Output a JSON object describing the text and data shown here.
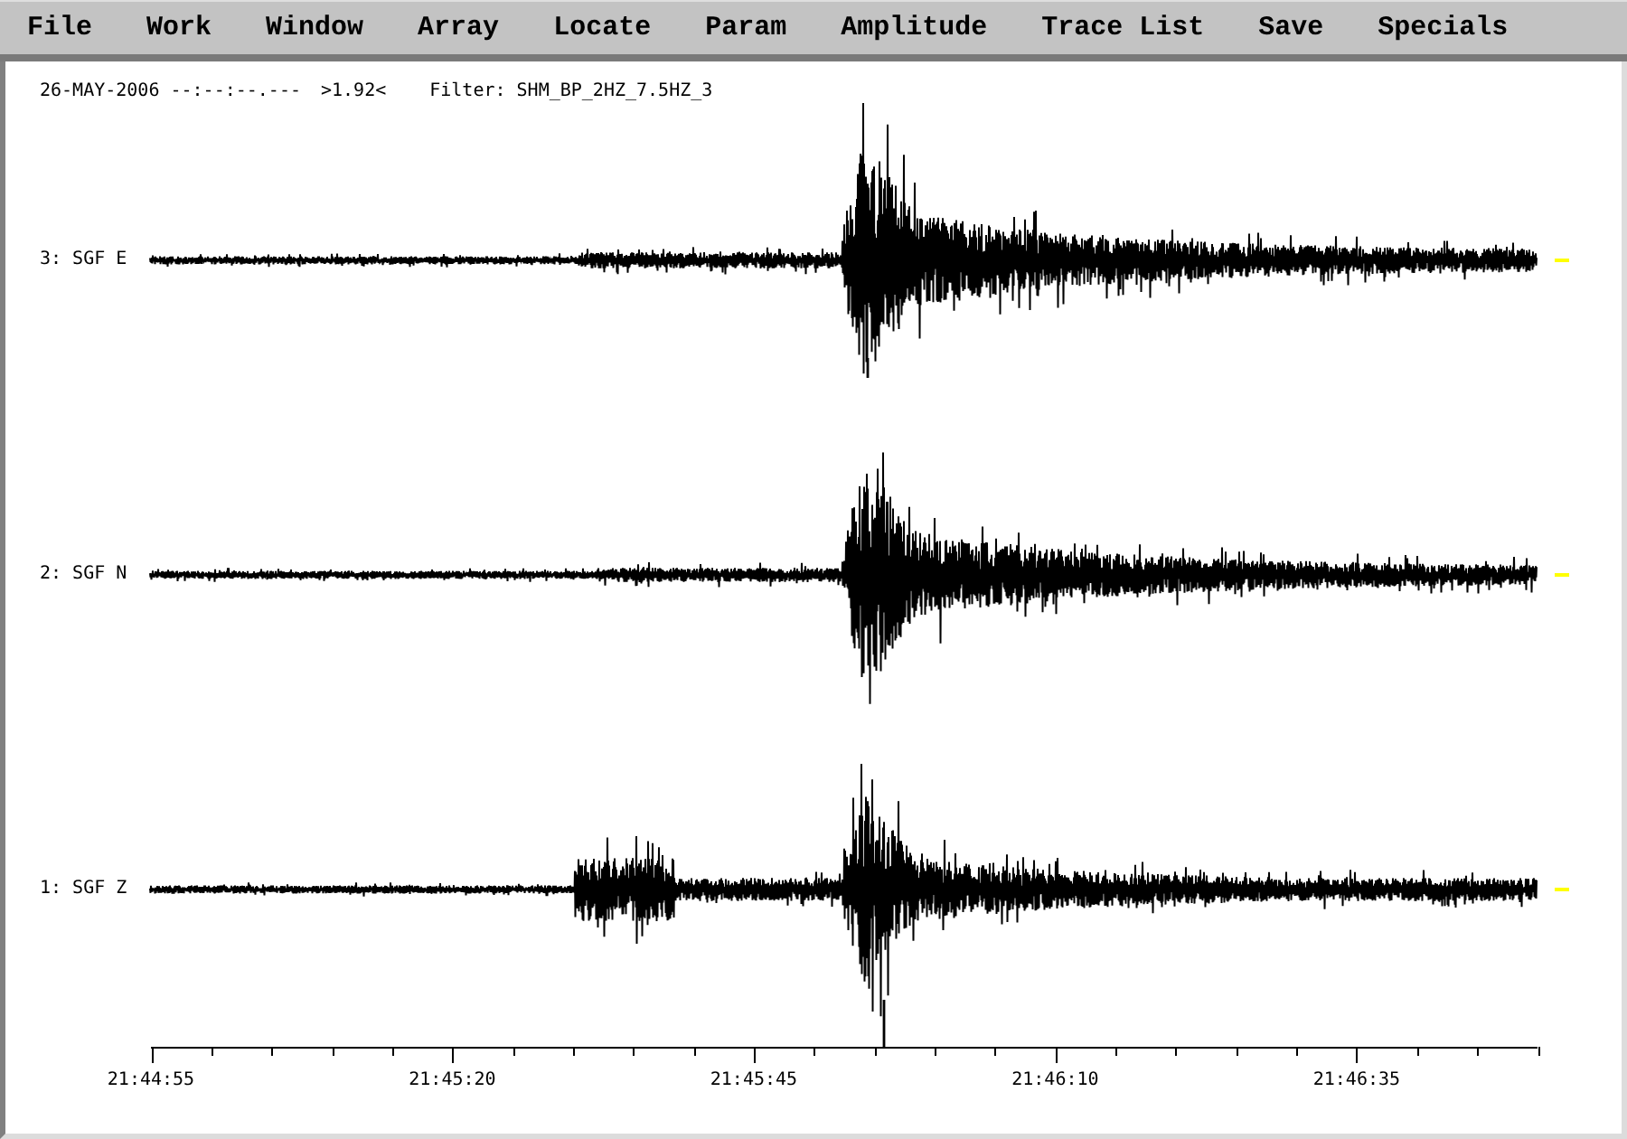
{
  "menu": [
    "File",
    "Work",
    "Window",
    "Array",
    "Locate",
    "Param",
    "Amplitude",
    "Trace List",
    "Save",
    "Specials"
  ],
  "header": {
    "date_time": "26-MAY-2006 --:--:--.---",
    "scale": ">1.92<",
    "filter": "Filter: SHM_BP_2HZ_7.5HZ_3"
  },
  "traces": [
    {
      "label": "3: SGF E"
    },
    {
      "label": "2: SGF N"
    },
    {
      "label": "1: SGF Z"
    }
  ],
  "time_axis": {
    "labels": [
      "21:44:55",
      "21:45:20",
      "21:45:45",
      "21:46:10",
      "21:46:35"
    ]
  }
}
